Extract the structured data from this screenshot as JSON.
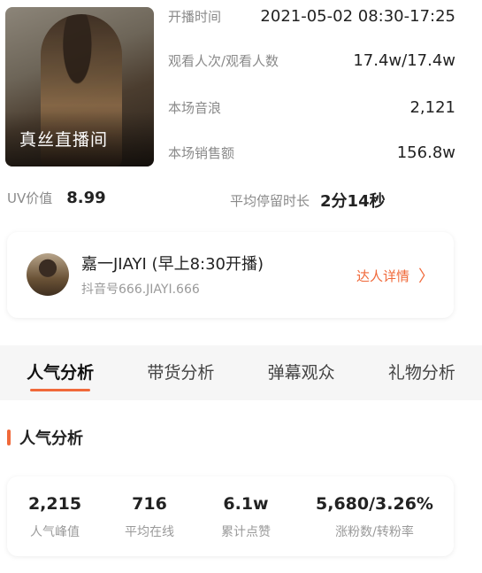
{
  "cover": {
    "title": "真丝直播间"
  },
  "stats": [
    {
      "label": "开播时间",
      "value": "2021-05-02 08:30-17:25"
    },
    {
      "label": "观看人次/观看人数",
      "value": "17.4w/17.4w"
    },
    {
      "label": "本场音浪",
      "value": "2,121"
    },
    {
      "label": "本场销售额",
      "value": "156.8w"
    }
  ],
  "uv": {
    "label": "UV价值",
    "value": "8.99"
  },
  "stay": {
    "label": "平均停留时长",
    "value": "2分14秒"
  },
  "host": {
    "name": "嘉一JIAYI (早上8:30开播)",
    "id": "抖音号666.JIAYI.666",
    "detail_label": "达人详情"
  },
  "tabs": [
    "人气分析",
    "带货分析",
    "弹幕观众",
    "礼物分析"
  ],
  "section": {
    "title": "人气分析"
  },
  "metrics": [
    {
      "value": "2,215",
      "label": "人气峰值"
    },
    {
      "value": "716",
      "label": "平均在线"
    },
    {
      "value": "6.1w",
      "label": "累计点赞"
    },
    {
      "value": "5,680/3.26%",
      "label": "涨粉数/转粉率"
    }
  ],
  "colors": {
    "accent": "#f0693a"
  },
  "icons": {
    "detail": "chevron-right-icon"
  }
}
